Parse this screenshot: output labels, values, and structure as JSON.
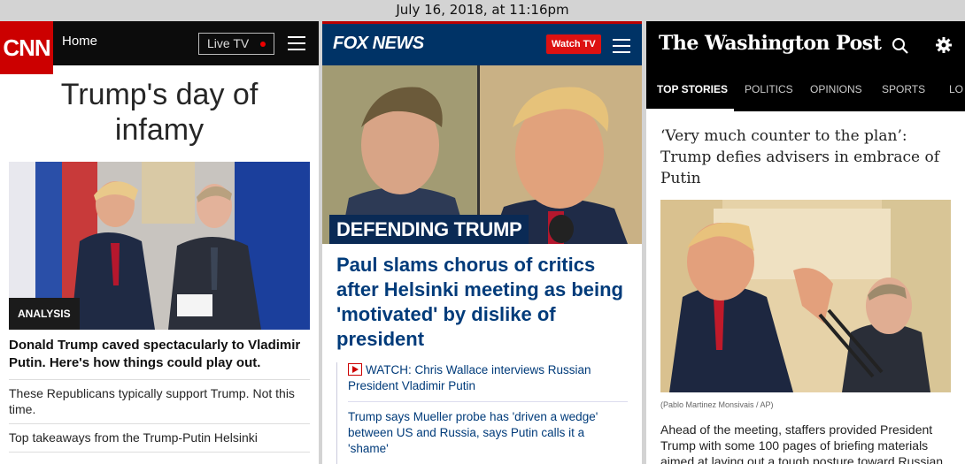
{
  "timestamp": "July 16, 2018, at 11:16pm",
  "cnn": {
    "logo": "CNN",
    "home": "Home",
    "live_tv": "Live TV",
    "headline": "Trump's day of infamy",
    "badge": "ANALYSIS",
    "story": "Donald Trump caved spectacularly to Vladimir Putin. Here's how things could play out.",
    "items": [
      "These Republicans typically support Trump. Not this time.",
      "Top takeaways from the Trump-Putin Helsinki"
    ]
  },
  "fox": {
    "logo": "FOX NEWS",
    "watch_tv": "Watch TV",
    "kicker": "DEFENDING TRUMP",
    "headline": "Paul slams chorus of critics after Helsinki meeting as being 'motivated' by dislike of president",
    "related": [
      "WATCH: Chris Wallace interviews Russian President Vladimir Putin",
      "Trump says Mueller probe has 'driven a wedge' between US and Russia, says Putin calls it a 'shame'"
    ]
  },
  "wapo": {
    "logo": "The Washington Post",
    "tabs": [
      "TOP STORIES",
      "POLITICS",
      "OPINIONS",
      "SPORTS",
      "LO"
    ],
    "headline": "‘Very much counter to the plan’: Trump defies advisers in embrace of Putin",
    "credit": "(Pablo Martinez Monsivais / AP)",
    "body": "Ahead of the meeting, staffers provided President Trump with some 100 pages of briefing materials aimed at laying out a tough posture toward Russian President Vladimir Putin, but Trump ignored most"
  },
  "colors": {
    "cnn_red": "#cc0000",
    "fox_blue": "#003366",
    "fox_link": "#003b7a",
    "wapo_black": "#000000"
  }
}
